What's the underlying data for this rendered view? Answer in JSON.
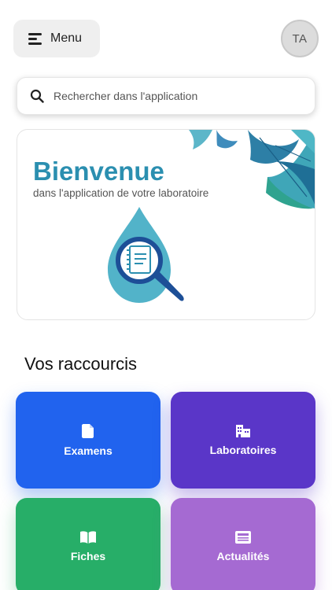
{
  "header": {
    "menu_label": "Menu",
    "avatar_initials": "TA"
  },
  "search": {
    "placeholder": "Rechercher dans l'application"
  },
  "banner": {
    "title": "Bienvenue",
    "subtitle": "dans l'application de votre laboratoire"
  },
  "shortcuts": {
    "title": "Vos raccourcis",
    "items": [
      {
        "label": "Examens",
        "icon": "document-icon",
        "color": "#2163ee"
      },
      {
        "label": "Laboratoires",
        "icon": "building-icon",
        "color": "#5a36c8"
      },
      {
        "label": "Fiches",
        "icon": "book-icon",
        "color": "#27ae68"
      },
      {
        "label": "Actualités",
        "icon": "newspaper-icon",
        "color": "#a56ad2"
      }
    ]
  },
  "colors": {
    "accent": "#2b8fb0"
  }
}
